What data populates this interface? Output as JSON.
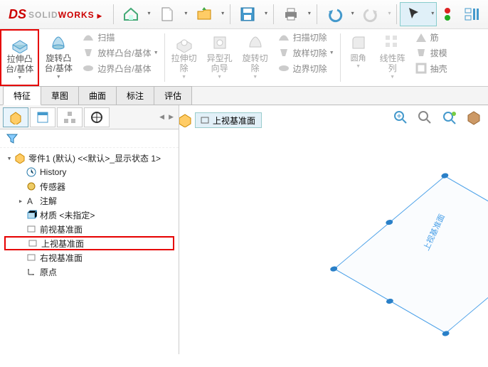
{
  "app": {
    "brand_ds": "DS",
    "brand_solid": "SOLID",
    "brand_works": "WORKS"
  },
  "ribbon": {
    "extrude": {
      "line1": "拉伸凸",
      "line2": "台/基体"
    },
    "revolve": {
      "line1": "旋转凸",
      "line2": "台/基体"
    },
    "sweep": "扫描",
    "loft": "放样凸台/基体",
    "boundary": "边界凸台/基体",
    "extcut": {
      "line1": "拉伸切",
      "line2": "除"
    },
    "hole": {
      "line1": "异型孔",
      "line2": "向导"
    },
    "revcut": {
      "line1": "旋转切",
      "line2": "除"
    },
    "sweepcut": "扫描切除",
    "loftcut": "放样切除",
    "boundcut": "边界切除",
    "fillet": "圆角",
    "lpattern": {
      "line1": "线性阵",
      "line2": "列"
    },
    "rib": "筋",
    "draft": "拔模",
    "shell": "抽壳"
  },
  "tabs": {
    "features": "特征",
    "sketch": "草图",
    "surface": "曲面",
    "annotate": "标注",
    "evaluate": "评估"
  },
  "tree": {
    "root": "零件1 (默认) <<默认>_显示状态 1>",
    "history": "History",
    "sensors": "传感器",
    "annotations": "注解",
    "material": "材质 <未指定>",
    "front_plane": "前视基准面",
    "top_plane": "上视基准面",
    "right_plane": "右视基准面",
    "origin": "原点"
  },
  "breadcrumb": {
    "plane": "上视基准面"
  },
  "viewport": {
    "plane_label": "上视基准面"
  },
  "colors": {
    "accent_red": "#e60000",
    "plane_blue": "#4aa0e8"
  }
}
